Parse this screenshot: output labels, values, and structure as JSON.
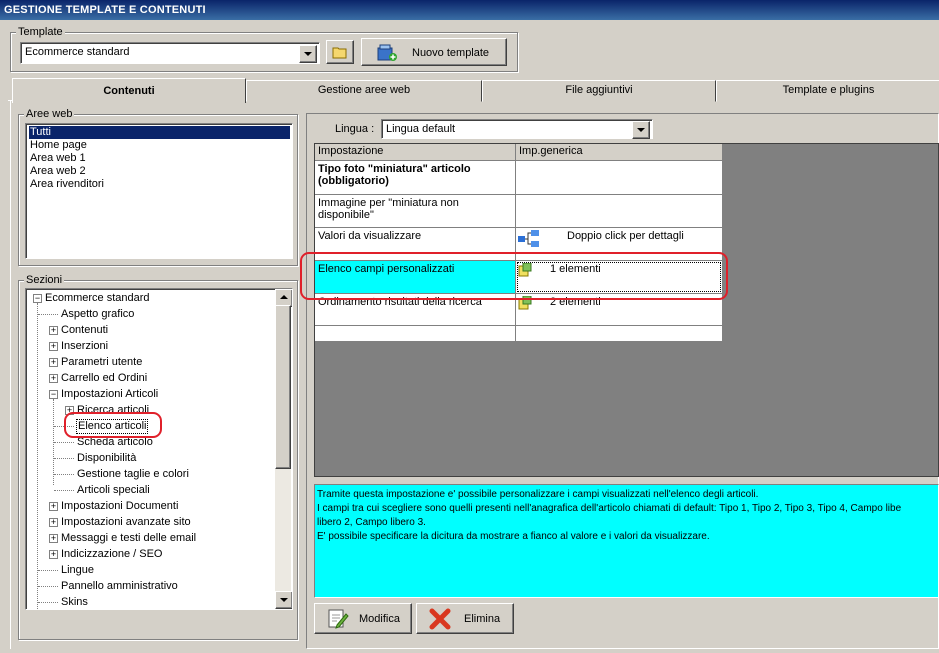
{
  "window": {
    "title": "GESTIONE TEMPLATE E CONTENUTI"
  },
  "template_group": {
    "legend": "Template",
    "selected": "Ecommerce standard",
    "new_button": "Nuovo template"
  },
  "tabs": [
    {
      "label": "Contenuti",
      "active": true
    },
    {
      "label": "Gestione aree web",
      "active": false
    },
    {
      "label": "File aggiuntivi",
      "active": false
    },
    {
      "label": "Template e plugins",
      "active": false
    }
  ],
  "aree_web": {
    "legend": "Aree web",
    "items": [
      "Tutti",
      "Home page",
      "Area web 1",
      "Area web 2",
      "Area rivenditori"
    ],
    "selected_index": 0
  },
  "sezioni": {
    "legend": "Sezioni",
    "tree": [
      {
        "label": "Ecommerce standard",
        "expander": "−"
      },
      {
        "label": "Aspetto grafico",
        "expander": ""
      },
      {
        "label": "Contenuti",
        "expander": "+"
      },
      {
        "label": "Inserzioni",
        "expander": "+"
      },
      {
        "label": "Parametri utente",
        "expander": "+"
      },
      {
        "label": "Carrello ed Ordini",
        "expander": "+"
      },
      {
        "label": "Impostazioni Articoli",
        "expander": "−"
      },
      {
        "label": "Ricerca articoli",
        "expander": "+"
      },
      {
        "label": "Elenco articoli",
        "expander": ""
      },
      {
        "label": "Scheda articolo",
        "expander": ""
      },
      {
        "label": "Disponibilità",
        "expander": ""
      },
      {
        "label": "Gestione taglie e colori",
        "expander": ""
      },
      {
        "label": "Articoli speciali",
        "expander": ""
      },
      {
        "label": "Impostazioni Documenti",
        "expander": "+"
      },
      {
        "label": "Impostazioni avanzate sito",
        "expander": "+"
      },
      {
        "label": "Messaggi e testi delle email",
        "expander": "+"
      },
      {
        "label": "Indicizzazione / SEO",
        "expander": "+"
      },
      {
        "label": "Lingue",
        "expander": ""
      },
      {
        "label": "Pannello amministrativo",
        "expander": ""
      },
      {
        "label": "Skins",
        "expander": ""
      }
    ]
  },
  "lingua": {
    "label": "Lingua :",
    "selected": "Lingua default"
  },
  "grid": {
    "headers": [
      "Impostazione",
      "Imp.generica"
    ],
    "rows": [
      {
        "setting": "Tipo foto \"miniatura\" articolo (obbligatorio)",
        "value": ""
      },
      {
        "setting": "Immagine per \"miniatura non disponibile\"",
        "value": ""
      },
      {
        "setting": "Valori da visualizzare",
        "value": "Doppio click per dettagli"
      },
      {
        "setting": "Elenco campi personalizzati",
        "value": "1 elementi"
      },
      {
        "setting": "Ordinamento risultati della ricerca",
        "value": "2 elementi"
      }
    ]
  },
  "description": {
    "lines": [
      "Tramite questa impostazione e' possibile personalizzare i campi visualizzati nell'elenco degli articoli.",
      "I campi tra cui scegliere sono quelli presenti nell'anagrafica dell'articolo chiamati di default: Tipo 1, Tipo 2, Tipo 3, Tipo 4, Campo libe",
      "libero 2, Campo libero 3.",
      "E' possibile specificare la dicitura da mostrare a fianco al valore e i valori da visualizzare."
    ]
  },
  "actions": {
    "modify": "Modifica",
    "delete": "Elimina"
  },
  "colors": {
    "highlight_cyan": "#00ffff",
    "selection_blue": "#0a246a",
    "annotation_red": "#e0202a"
  }
}
